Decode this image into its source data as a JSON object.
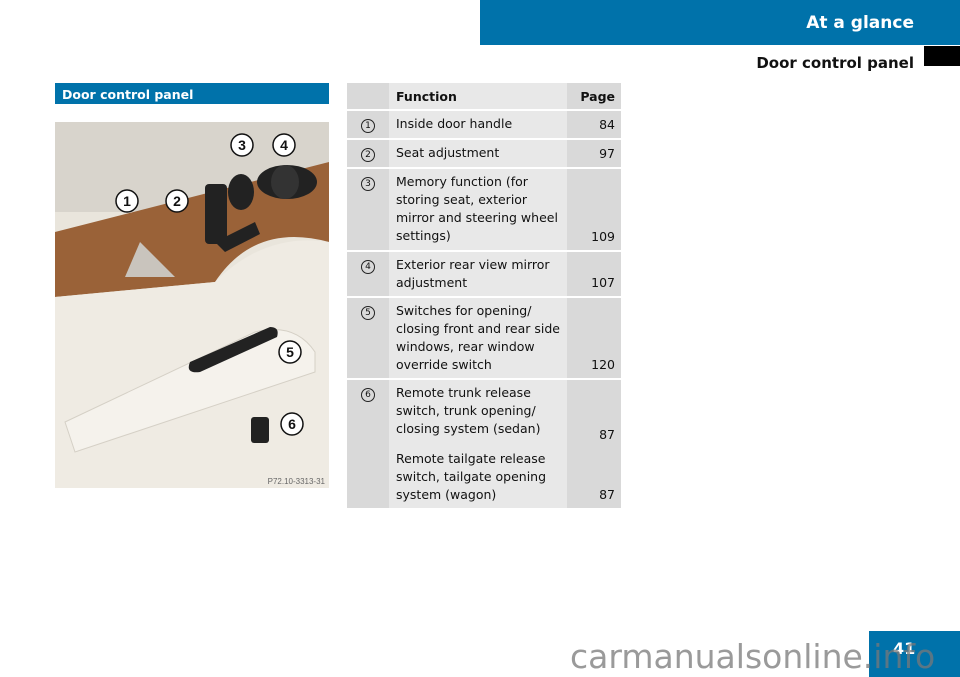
{
  "header": {
    "section": "At a glance",
    "subsection": "Door control panel",
    "page_number": "41"
  },
  "left": {
    "title": "Door control panel",
    "image_code": "P72.10-3313-31",
    "callouts": [
      "1",
      "2",
      "3",
      "4",
      "5",
      "6"
    ]
  },
  "table": {
    "headers": {
      "function": "Function",
      "page": "Page"
    },
    "rows": [
      {
        "num": "1",
        "items": [
          {
            "function": "Inside door handle",
            "page": "84"
          }
        ]
      },
      {
        "num": "2",
        "items": [
          {
            "function": "Seat adjustment",
            "page": "97"
          }
        ]
      },
      {
        "num": "3",
        "items": [
          {
            "function": "Memory function (for storing seat, exterior mirror and steering wheel settings)",
            "page": "109"
          }
        ]
      },
      {
        "num": "4",
        "items": [
          {
            "function": "Exterior rear view mirror adjustment",
            "page": "107"
          }
        ]
      },
      {
        "num": "5",
        "items": [
          {
            "function": "Switches for opening/ closing front and rear side windows, rear window override switch",
            "page": "120"
          }
        ]
      },
      {
        "num": "6",
        "items": [
          {
            "function": "Remote trunk release switch, trunk opening/ closing system (sedan)",
            "page": "87"
          },
          {
            "function": "Remote tailgate release switch, tailgate opening system (wagon)",
            "page": "87"
          }
        ]
      }
    ]
  },
  "watermark": "carmanualsonline.info",
  "colors": {
    "accent": "#0072aa"
  }
}
